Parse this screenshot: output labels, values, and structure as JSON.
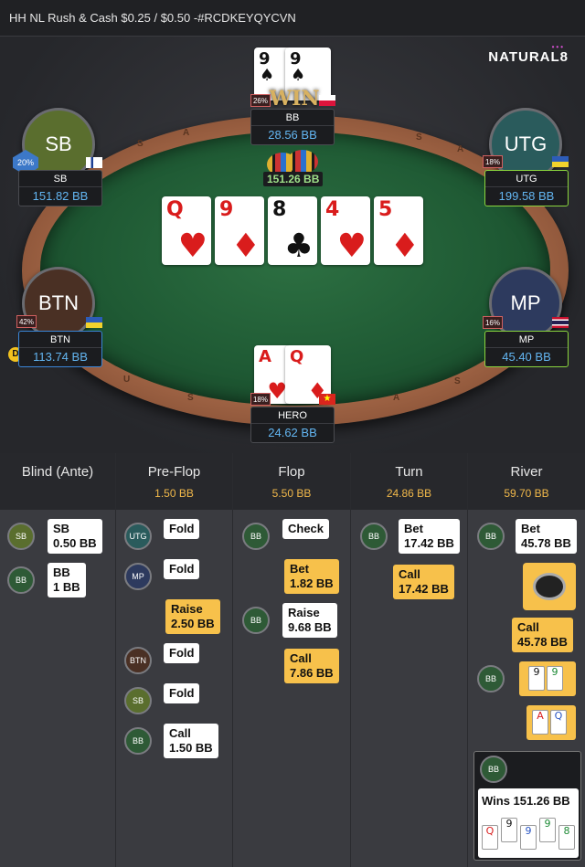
{
  "title": "HH NL Rush & Cash $0.25 / $0.50 -#RCDKEYQYCVN",
  "brand": "NATURAL8",
  "board": [
    {
      "rank": "Q",
      "suit": "♥",
      "color": "red"
    },
    {
      "rank": "9",
      "suit": "♦",
      "color": "red"
    },
    {
      "rank": "8",
      "suit": "♣",
      "color": "blk"
    },
    {
      "rank": "4",
      "suit": "♥",
      "color": "red"
    },
    {
      "rank": "5",
      "suit": "♦",
      "color": "red"
    }
  ],
  "win_text": "WIN",
  "pot": "151.26 BB",
  "seats": {
    "bb": {
      "name": "BB",
      "stack": "28.56 BB",
      "pct": "26%",
      "cards": [
        {
          "rank": "9",
          "suit": "♠"
        },
        {
          "rank": "9",
          "suit": "♠"
        }
      ]
    },
    "sb": {
      "avatar": "SB",
      "name": "SB",
      "stack": "151.82 BB",
      "pct": "20%"
    },
    "utg": {
      "avatar": "UTG",
      "name": "UTG",
      "stack": "199.58 BB",
      "pct": "18%"
    },
    "btn": {
      "avatar": "BTN",
      "name": "BTN",
      "stack": "113.74 BB",
      "pct": "42%",
      "dealer": "D"
    },
    "mp": {
      "avatar": "MP",
      "name": "MP",
      "stack": "45.40 BB",
      "pct": "16%"
    },
    "hero": {
      "name": "HERO",
      "stack": "24.62 BB",
      "pct": "18%",
      "cards": [
        {
          "rank": "A",
          "suit": "♥"
        },
        {
          "rank": "Q",
          "suit": "♦"
        }
      ]
    }
  },
  "history": {
    "blind": {
      "title": "Blind (Ante)",
      "actions": [
        {
          "who": "SB",
          "text": "SB\n0.50 BB"
        },
        {
          "who": "BB",
          "text": "BB\n1 BB"
        }
      ]
    },
    "preflop": {
      "title": "Pre-Flop",
      "pot": "1.50 BB",
      "actions": [
        {
          "who": "UTG",
          "text": "Fold"
        },
        {
          "who": "MP",
          "text": "Fold"
        },
        {
          "who": "",
          "text": "Raise\n2.50 BB"
        },
        {
          "who": "BTN",
          "text": "Fold"
        },
        {
          "who": "SB",
          "text": "Fold"
        },
        {
          "who": "BB",
          "text": "Call\n1.50 BB"
        }
      ]
    },
    "flop": {
      "title": "Flop",
      "pot": "5.50 BB",
      "actions": [
        {
          "who": "BB",
          "text": "Check"
        },
        {
          "who": "",
          "text": "Bet\n1.82 BB"
        },
        {
          "who": "BB",
          "text": "Raise\n9.68 BB"
        },
        {
          "who": "",
          "text": "Call\n7.86 BB"
        }
      ]
    },
    "turn": {
      "title": "Turn",
      "pot": "24.86 BB",
      "actions": [
        {
          "who": "BB",
          "text": "Bet\n17.42 BB"
        },
        {
          "who": "",
          "text": "Call\n17.42 BB"
        }
      ]
    },
    "river": {
      "title": "River",
      "pot": "59.70 BB",
      "actions": [
        {
          "who": "BB",
          "text": "Bet\n45.78 BB"
        },
        {
          "who": "",
          "text": "Call\n45.78 BB"
        }
      ],
      "result": "Wins 151.26 BB"
    }
  },
  "colors": {
    "accent": "#f7c14b",
    "stack": "#63b6f2",
    "felt": "#1f5a34"
  }
}
